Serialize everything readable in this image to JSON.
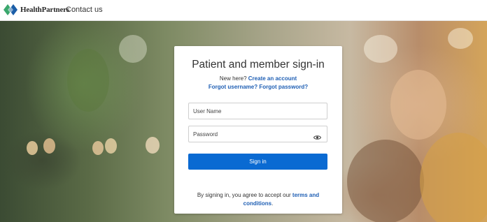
{
  "header": {
    "brand": "HealthPartners",
    "contact_label": "Contact us"
  },
  "login": {
    "title": "Patient and member sign-in",
    "new_here": "New here?",
    "create_account": "Create an account",
    "forgot_username": "Forgot username?",
    "forgot_password": "Forgot password?",
    "username_placeholder": "User Name",
    "password_placeholder": "Password",
    "signin_label": "Sign in",
    "terms_prefix": "By signing in, you agree to accept our",
    "terms_link": "terms and conditions",
    "terms_suffix": "."
  },
  "colors": {
    "accent": "#0a6ad2",
    "link": "#1f5fb4",
    "logo_green": "#3aa76d",
    "logo_blue": "#1b5ea8"
  },
  "icons": {
    "logo": "healthpartners-diamond-logo",
    "password_toggle": "eye-icon"
  }
}
